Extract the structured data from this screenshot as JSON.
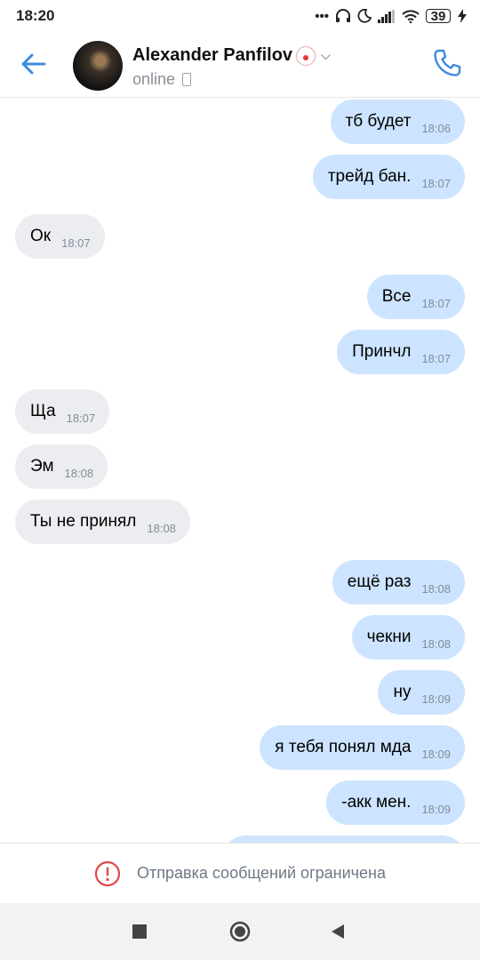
{
  "status": {
    "time": "18:20",
    "battery": "39"
  },
  "header": {
    "name": "Alexander Panfilov",
    "presence": "online"
  },
  "messages": [
    {
      "text": "тб будет",
      "time": "18:06",
      "dir": "out"
    },
    {
      "text": "трейд бан.",
      "time": "18:07",
      "dir": "out"
    },
    {
      "text": "Ок",
      "time": "18:07",
      "dir": "in"
    },
    {
      "text": "Все",
      "time": "18:07",
      "dir": "out"
    },
    {
      "text": "Принчл",
      "time": "18:07",
      "dir": "out"
    },
    {
      "text": "Ща",
      "time": "18:07",
      "dir": "in"
    },
    {
      "text": "Эм",
      "time": "18:08",
      "dir": "in"
    },
    {
      "text": "Ты не принял",
      "time": "18:08",
      "dir": "in"
    },
    {
      "text": "ещё раз",
      "time": "18:08",
      "dir": "out"
    },
    {
      "text": "чекни",
      "time": "18:08",
      "dir": "out"
    },
    {
      "text": "ну",
      "time": "18:09",
      "dir": "out"
    },
    {
      "text": "я тебя понял мда",
      "time": "18:09",
      "dir": "out"
    },
    {
      "text": "-акк мен.",
      "time": "18:09",
      "dir": "out"
    }
  ],
  "restriction": {
    "text": "Отправка сообщений ограничена"
  },
  "colors": {
    "accent": "#3f8ae0",
    "outgoing_bubble": "#cce4ff",
    "incoming_bubble": "#ebedf0",
    "warning": "#e64646"
  }
}
